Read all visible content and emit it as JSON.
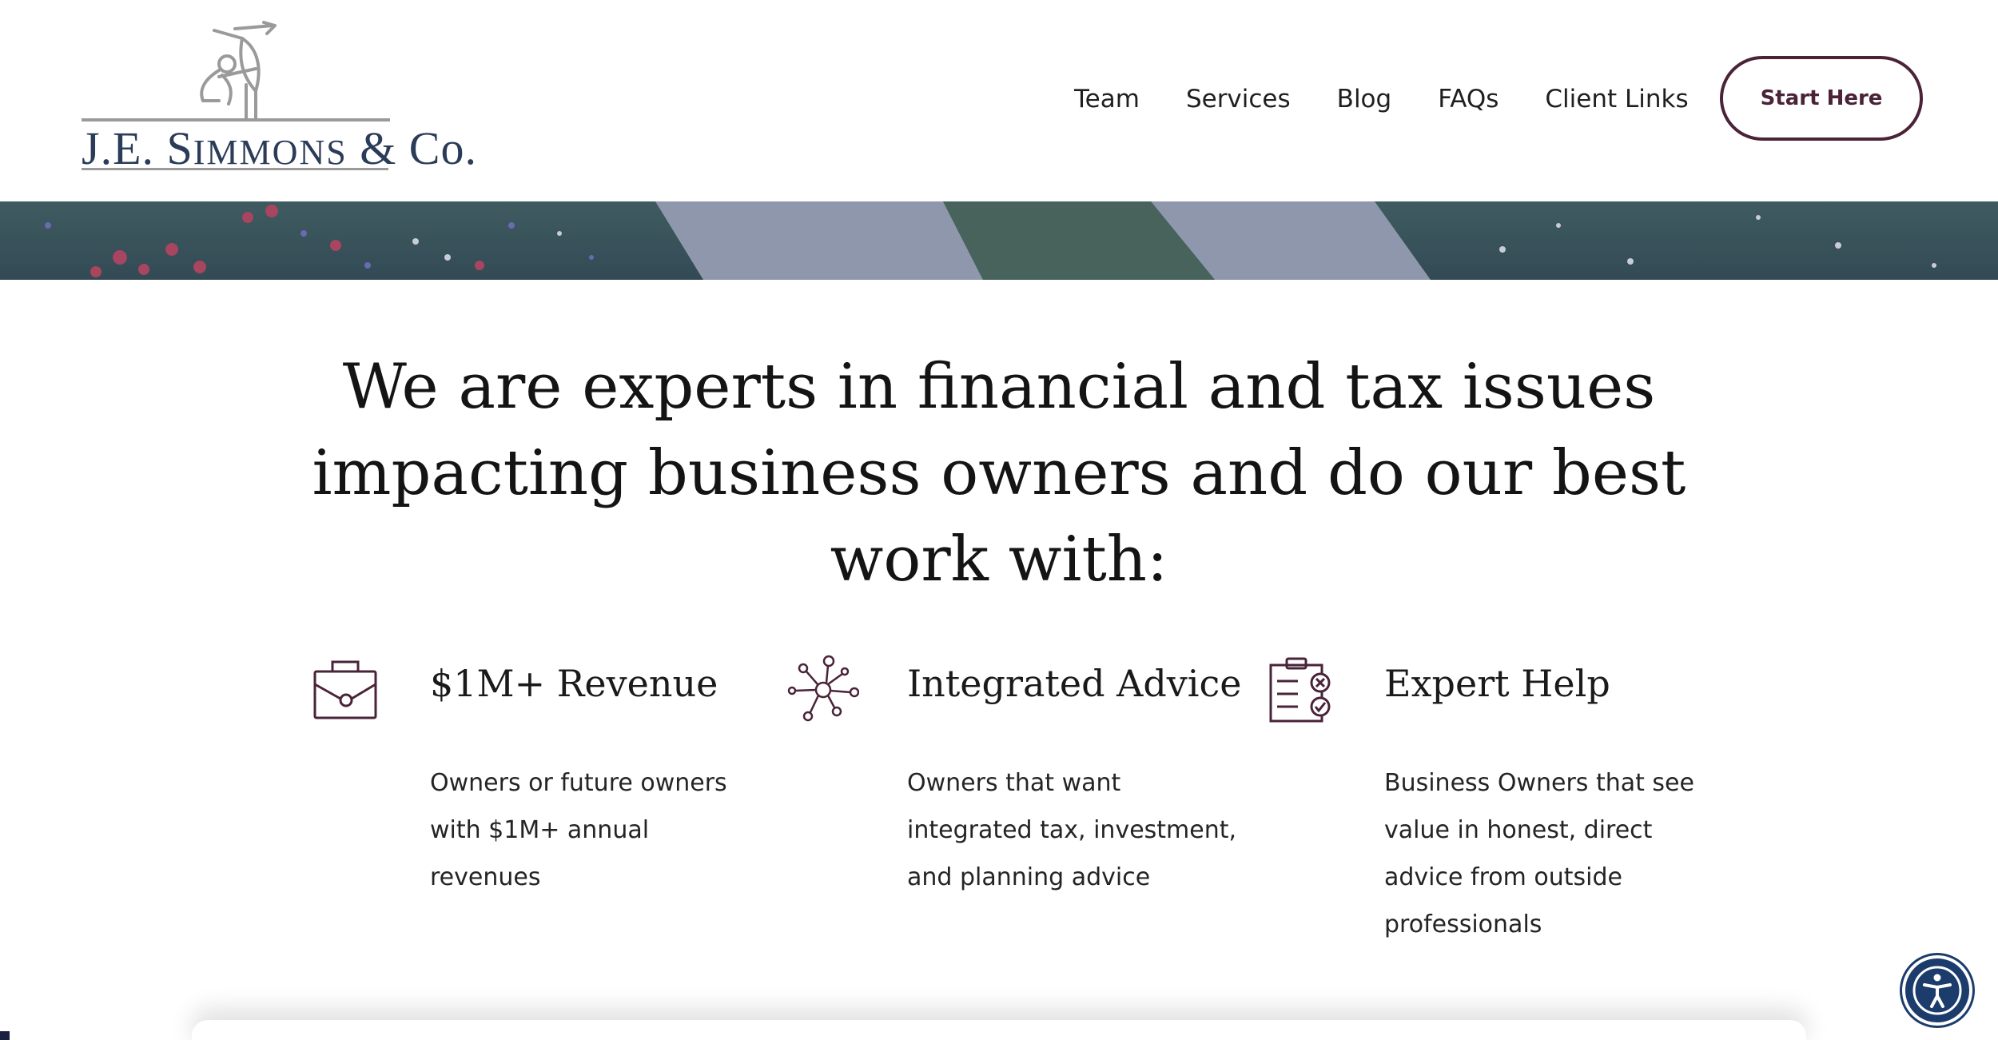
{
  "brand": {
    "logo_name_initial": "J.E. S",
    "logo_name_rest": "IMMONS",
    "logo_name_end": " & Co."
  },
  "nav": {
    "items": [
      "Team",
      "Services",
      "Blog",
      "FAQs",
      "Client Links"
    ],
    "cta_label": "Start Here"
  },
  "main": {
    "headline": "We are experts in financial and tax issues impacting business owners and do our best work with:",
    "features": [
      {
        "icon": "briefcase-icon",
        "title": "$1M+ Revenue",
        "description": "Owners or future owners with $1M+ annual revenues"
      },
      {
        "icon": "network-icon",
        "title": "Integrated Advice",
        "description": "Owners that want integrated tax, investment, and planning advice"
      },
      {
        "icon": "clipboard-check-icon",
        "title": "Expert Help",
        "description": "Business Owners that see value in honest, direct advice from outside professionals"
      }
    ]
  },
  "colors": {
    "brand_plum": "#4a2338",
    "logo_navy": "#2a3c57",
    "hero_tint": "#4d5d78",
    "a11y_blue": "#1c3c6c"
  }
}
